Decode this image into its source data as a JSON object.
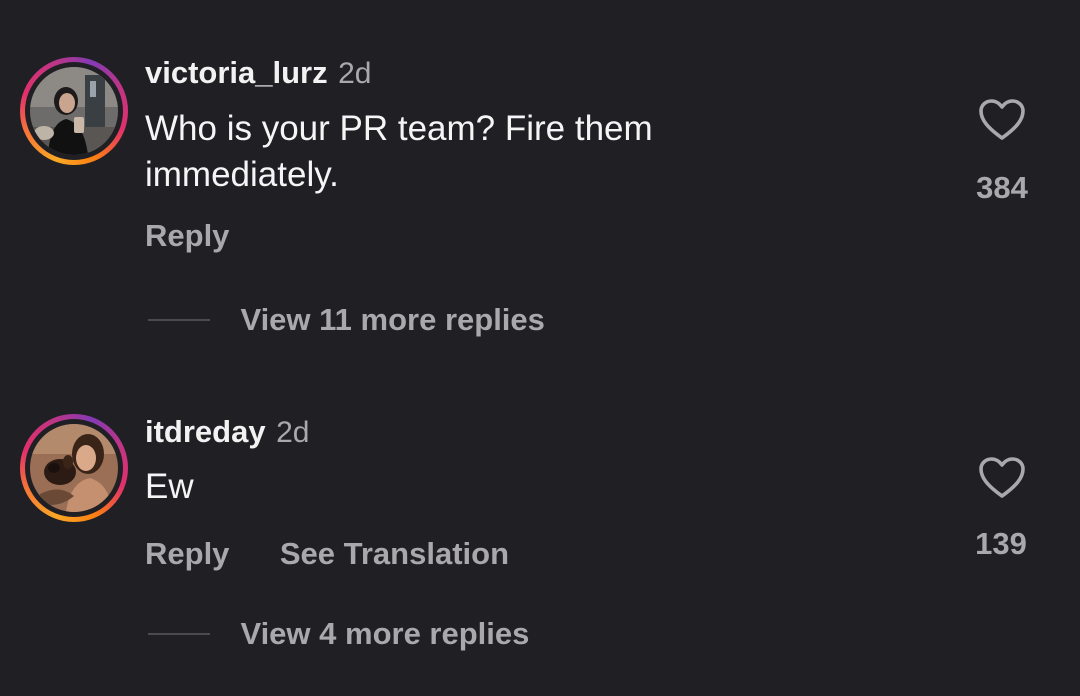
{
  "comments": [
    {
      "username": "victoria_lurz",
      "time": "2d",
      "text": "Who is your PR team? Fire them immediately.",
      "actions": [
        "Reply"
      ],
      "likes": "384",
      "view_replies": "View 11 more replies",
      "avatar_icon": "user-photo-mirror-selfie"
    },
    {
      "username": "itdreday",
      "time": "2d",
      "text": "Ew",
      "actions": [
        "Reply",
        "See Translation"
      ],
      "likes": "139",
      "view_replies": "View 4 more replies",
      "avatar_icon": "user-photo-with-dog"
    }
  ],
  "colors": {
    "background": "#202024",
    "primary_text": "#f5f5f5",
    "secondary_text": "#a8a8ad",
    "ring_gradient": [
      "#f9a825",
      "#e1306c",
      "#833ab4"
    ]
  }
}
